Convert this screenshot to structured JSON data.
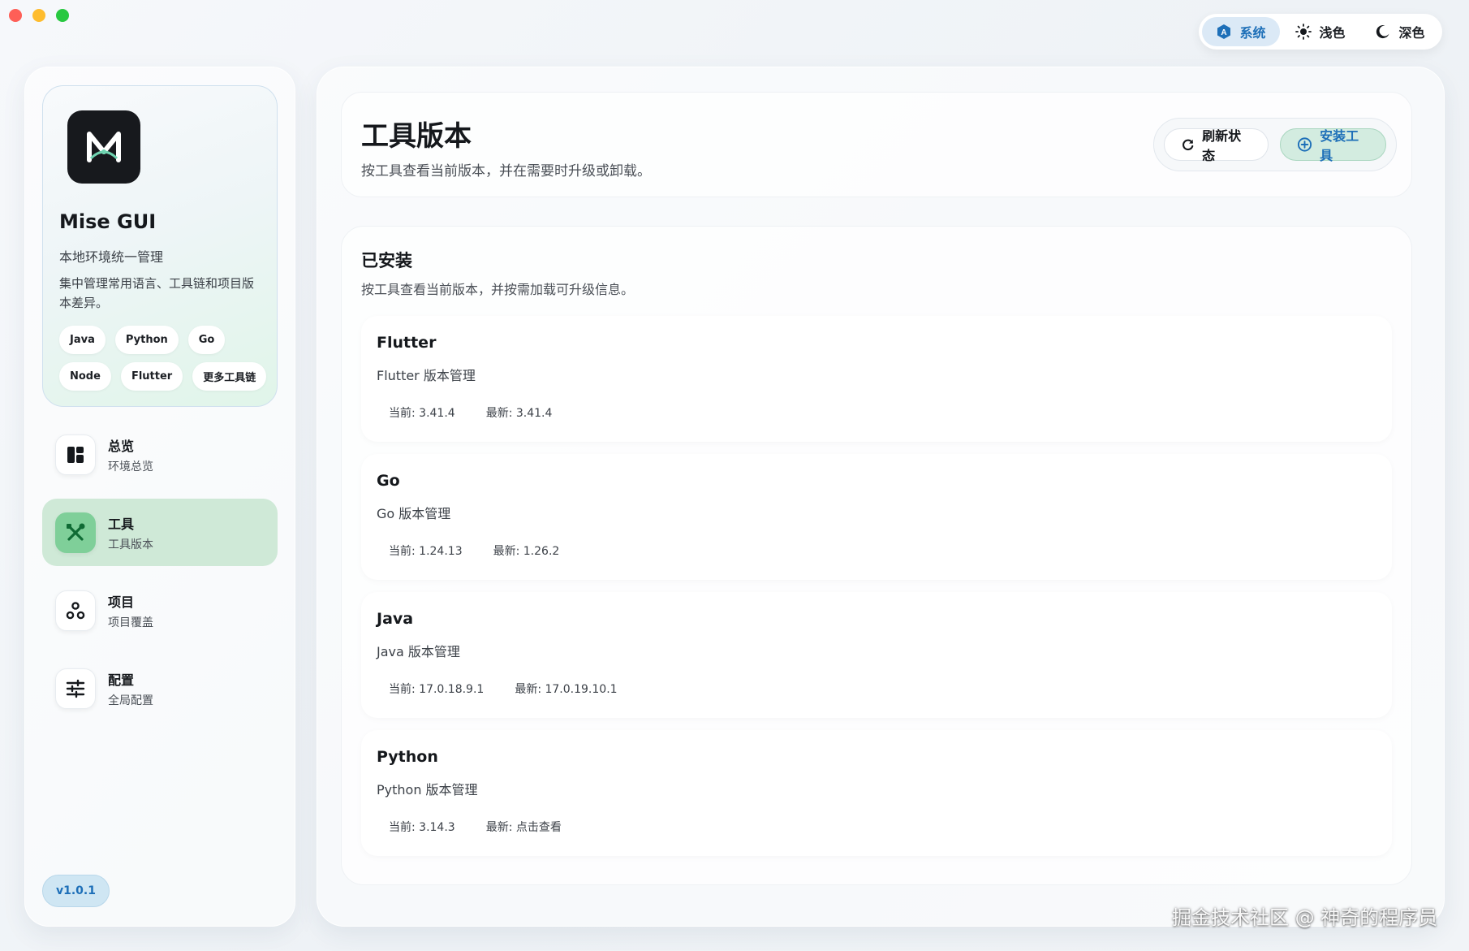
{
  "theme": {
    "options": [
      {
        "label": "系统",
        "icon": "system-theme-icon"
      },
      {
        "label": "浅色",
        "icon": "sun-icon"
      },
      {
        "label": "深色",
        "icon": "moon-icon"
      }
    ],
    "active": "系统"
  },
  "brand": {
    "title": "Mise GUI",
    "subtitle": "本地环境统一管理",
    "description": "集中管理常用语言、工具链和项目版本差异。",
    "chips": [
      "Java",
      "Python",
      "Go",
      "Node",
      "Flutter",
      "更多工具链"
    ]
  },
  "nav": {
    "items": [
      {
        "title": "总览",
        "subtitle": "环境总览",
        "icon": "dashboard-icon"
      },
      {
        "title": "工具",
        "subtitle": "工具版本",
        "icon": "tools-icon"
      },
      {
        "title": "项目",
        "subtitle": "项目覆盖",
        "icon": "project-icon"
      },
      {
        "title": "配置",
        "subtitle": "全局配置",
        "icon": "settings-sliders-icon"
      }
    ],
    "active_index": 1
  },
  "version": "v1.0.1",
  "header": {
    "title": "工具版本",
    "subtitle": "按工具查看当前版本，并在需要时升级或卸载。",
    "refresh_label": "刷新状态",
    "install_label": "安装工具"
  },
  "installed": {
    "title": "已安装",
    "subtitle": "按工具查看当前版本，并按需加载可升级信息。",
    "tools": [
      {
        "name": "Flutter",
        "desc": "Flutter 版本管理",
        "current": "当前: 3.41.4",
        "latest": "最新: 3.41.4"
      },
      {
        "name": "Go",
        "desc": "Go 版本管理",
        "current": "当前: 1.24.13",
        "latest": "最新: 1.26.2"
      },
      {
        "name": "Java",
        "desc": "Java 版本管理",
        "current": "当前: 17.0.18.9.1",
        "latest": "最新: 17.0.19.10.1"
      },
      {
        "name": "Python",
        "desc": "Python 版本管理",
        "current": "当前: 3.14.3",
        "latest": "最新: 点击查看"
      }
    ]
  },
  "watermark": "掘金技术社区 @ 神奇的程序员",
  "colors": {
    "accent_blue": "#1d6fb8",
    "accent_green": "#7fcf99",
    "active_nav_bg": "#cfe9d7"
  }
}
